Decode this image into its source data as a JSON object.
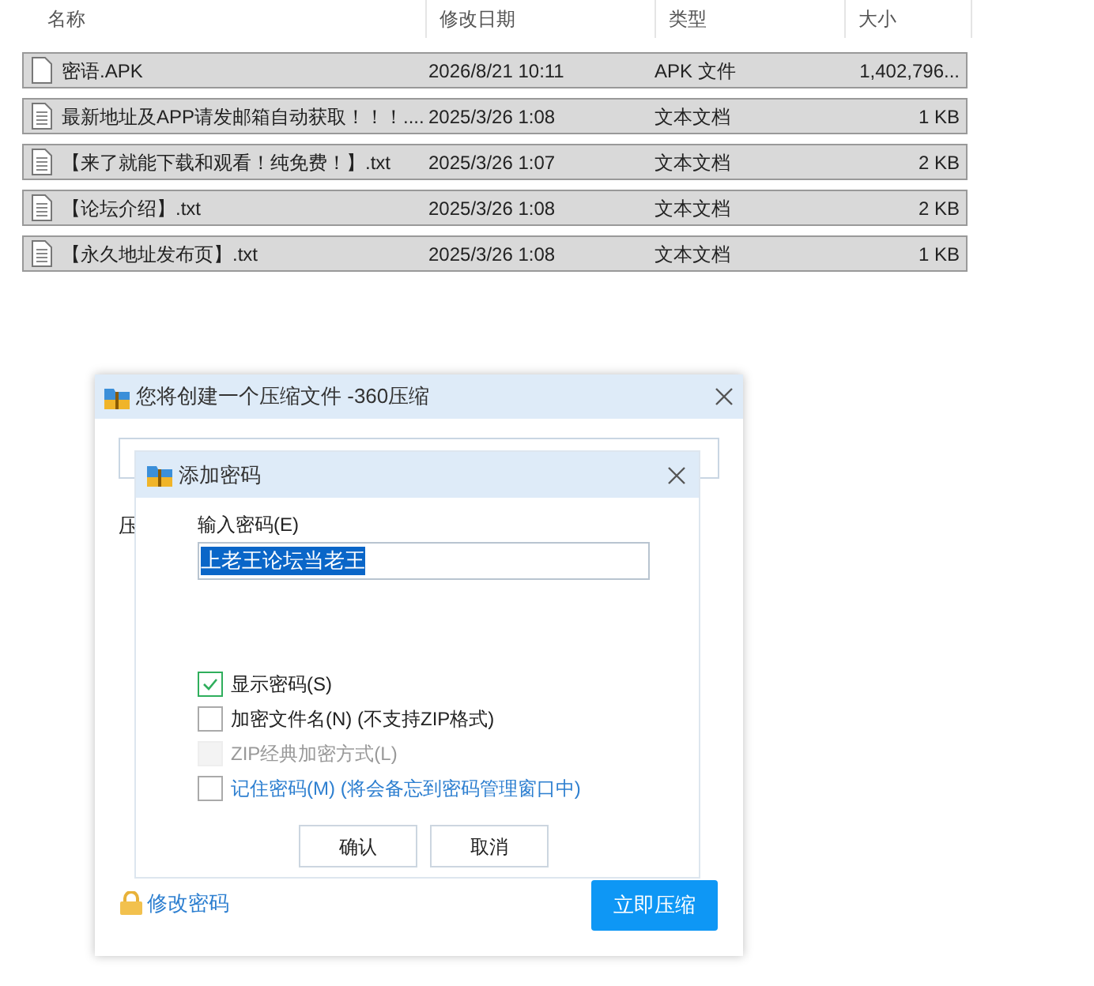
{
  "file_list": {
    "columns": [
      "名称",
      "修改日期",
      "类型",
      "大小"
    ],
    "rows": [
      {
        "kind": "blank",
        "name": "密语.APK",
        "date": "2026/8/21 10:11",
        "type": "APK 文件",
        "size": "1,402,796..."
      },
      {
        "kind": "text",
        "name": "最新地址及APP请发邮箱自动获取！！！....",
        "date": "2025/3/26 1:08",
        "type": "文本文档",
        "size": "1 KB"
      },
      {
        "kind": "text",
        "name": "【来了就能下载和观看！纯免费！】.txt",
        "date": "2025/3/26 1:07",
        "type": "文本文档",
        "size": "2 KB"
      },
      {
        "kind": "text",
        "name": "【论坛介绍】.txt",
        "date": "2025/3/26 1:08",
        "type": "文本文档",
        "size": "2 KB"
      },
      {
        "kind": "text",
        "name": "【永久地址发布页】.txt",
        "date": "2025/3/26 1:08",
        "type": "文本文档",
        "size": "1 KB"
      }
    ]
  },
  "compress_dialog": {
    "title": "您将创建一个压缩文件 -360压缩",
    "label": "压",
    "change_password_link": "修改密码",
    "compress_button": "立即压缩"
  },
  "password_dialog": {
    "title": "添加密码",
    "field_label": "输入密码(E)",
    "password_value": "上老王论坛当老王",
    "options": [
      {
        "label": "显示密码(S)",
        "checked": true,
        "disabled": false,
        "link": false
      },
      {
        "label": "加密文件名(N) (不支持ZIP格式)",
        "checked": false,
        "disabled": false,
        "link": false
      },
      {
        "label": "ZIP经典加密方式(L)",
        "checked": false,
        "disabled": true,
        "link": false
      },
      {
        "label": "记住密码(M) (将会备忘到密码管理窗口中)",
        "checked": false,
        "disabled": false,
        "link": true
      }
    ],
    "buttons": [
      "确认",
      "取消"
    ]
  }
}
